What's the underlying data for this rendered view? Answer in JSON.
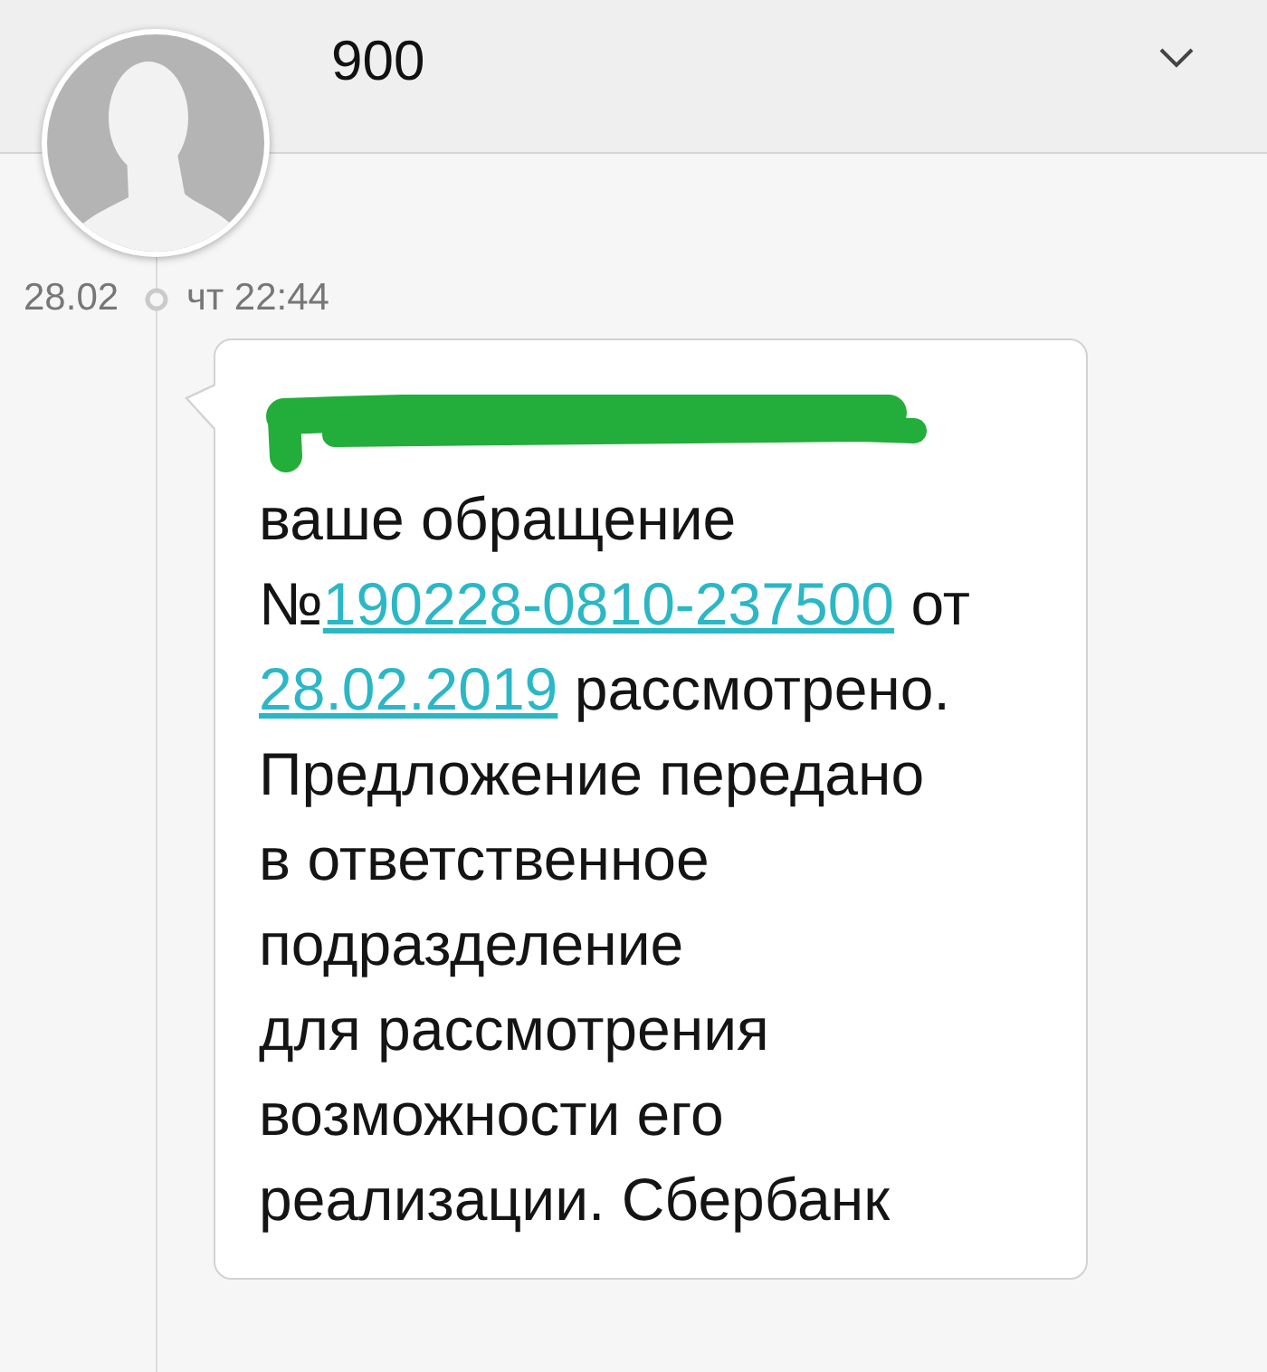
{
  "header": {
    "title": "900"
  },
  "thread": {
    "date": "28.02",
    "time": "чт 22:44"
  },
  "message": {
    "redacted_first_line": true,
    "segments": [
      {
        "kind": "text",
        "text": "ваше обращение\n№"
      },
      {
        "kind": "link",
        "text": "190228-0810-237500"
      },
      {
        "kind": "text",
        "text": " от\n"
      },
      {
        "kind": "link",
        "text": "28.02.2019"
      },
      {
        "kind": "text",
        "text": " рассмотрено.\nПредложение передано\nв ответственное\nподразделение\nдля рассмотрения\nвозможности его\nреализации. Сбербанк"
      }
    ]
  }
}
